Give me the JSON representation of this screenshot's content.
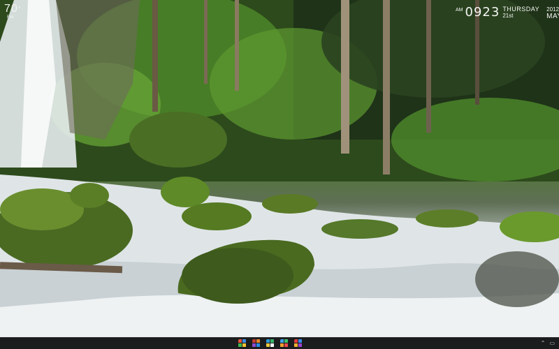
{
  "weather": {
    "temperature": "70",
    "degree_symbol": "°",
    "condition": "Fair"
  },
  "clock": {
    "ampm": "AM",
    "time": "0923",
    "weekday": "THURSDAY",
    "date": "21st",
    "year": "2012",
    "month": "MAY"
  },
  "taskbar": {
    "apps": [
      {
        "icon": "grid-app-icon",
        "colors": [
          "#e6553a",
          "#3c8de0",
          "#3fb84d",
          "#f2c230"
        ]
      },
      {
        "icon": "grid-app-icon",
        "colors": [
          "#c43b2e",
          "#e0862c",
          "#8a4bd0",
          "#2b8be0"
        ]
      },
      {
        "icon": "grid-app-icon",
        "colors": [
          "#2e9ad8",
          "#36b36b",
          "#e8c93a",
          "#ffffff"
        ]
      },
      {
        "icon": "grid-app-icon",
        "colors": [
          "#3ca0e8",
          "#3ac06a",
          "#f0a030",
          "#e84a4a"
        ]
      },
      {
        "icon": "grid-app-icon",
        "colors": [
          "#e23c3c",
          "#3a8ce8",
          "#f0b030",
          "#9a40d0"
        ]
      }
    ],
    "tray": {
      "expand_icon": "chevron-up-icon",
      "display_icon": "display-icon"
    }
  }
}
